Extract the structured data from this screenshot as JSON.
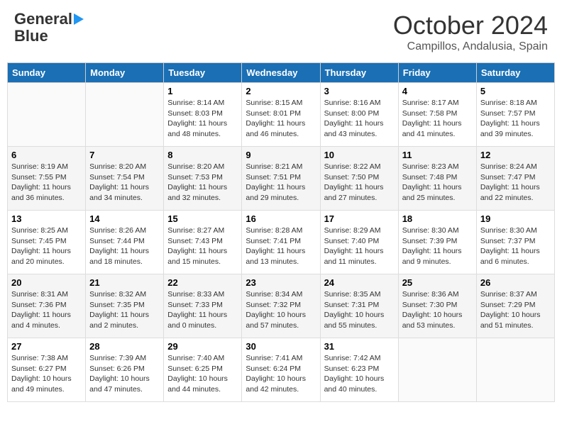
{
  "logo": {
    "line1": "General",
    "line2": "Blue"
  },
  "header": {
    "month": "October 2024",
    "location": "Campillos, Andalusia, Spain"
  },
  "weekdays": [
    "Sunday",
    "Monday",
    "Tuesday",
    "Wednesday",
    "Thursday",
    "Friday",
    "Saturday"
  ],
  "weeks": [
    [
      {
        "day": "",
        "info": ""
      },
      {
        "day": "",
        "info": ""
      },
      {
        "day": "1",
        "info": "Sunrise: 8:14 AM\nSunset: 8:03 PM\nDaylight: 11 hours and 48 minutes."
      },
      {
        "day": "2",
        "info": "Sunrise: 8:15 AM\nSunset: 8:01 PM\nDaylight: 11 hours and 46 minutes."
      },
      {
        "day": "3",
        "info": "Sunrise: 8:16 AM\nSunset: 8:00 PM\nDaylight: 11 hours and 43 minutes."
      },
      {
        "day": "4",
        "info": "Sunrise: 8:17 AM\nSunset: 7:58 PM\nDaylight: 11 hours and 41 minutes."
      },
      {
        "day": "5",
        "info": "Sunrise: 8:18 AM\nSunset: 7:57 PM\nDaylight: 11 hours and 39 minutes."
      }
    ],
    [
      {
        "day": "6",
        "info": "Sunrise: 8:19 AM\nSunset: 7:55 PM\nDaylight: 11 hours and 36 minutes."
      },
      {
        "day": "7",
        "info": "Sunrise: 8:20 AM\nSunset: 7:54 PM\nDaylight: 11 hours and 34 minutes."
      },
      {
        "day": "8",
        "info": "Sunrise: 8:20 AM\nSunset: 7:53 PM\nDaylight: 11 hours and 32 minutes."
      },
      {
        "day": "9",
        "info": "Sunrise: 8:21 AM\nSunset: 7:51 PM\nDaylight: 11 hours and 29 minutes."
      },
      {
        "day": "10",
        "info": "Sunrise: 8:22 AM\nSunset: 7:50 PM\nDaylight: 11 hours and 27 minutes."
      },
      {
        "day": "11",
        "info": "Sunrise: 8:23 AM\nSunset: 7:48 PM\nDaylight: 11 hours and 25 minutes."
      },
      {
        "day": "12",
        "info": "Sunrise: 8:24 AM\nSunset: 7:47 PM\nDaylight: 11 hours and 22 minutes."
      }
    ],
    [
      {
        "day": "13",
        "info": "Sunrise: 8:25 AM\nSunset: 7:45 PM\nDaylight: 11 hours and 20 minutes."
      },
      {
        "day": "14",
        "info": "Sunrise: 8:26 AM\nSunset: 7:44 PM\nDaylight: 11 hours and 18 minutes."
      },
      {
        "day": "15",
        "info": "Sunrise: 8:27 AM\nSunset: 7:43 PM\nDaylight: 11 hours and 15 minutes."
      },
      {
        "day": "16",
        "info": "Sunrise: 8:28 AM\nSunset: 7:41 PM\nDaylight: 11 hours and 13 minutes."
      },
      {
        "day": "17",
        "info": "Sunrise: 8:29 AM\nSunset: 7:40 PM\nDaylight: 11 hours and 11 minutes."
      },
      {
        "day": "18",
        "info": "Sunrise: 8:30 AM\nSunset: 7:39 PM\nDaylight: 11 hours and 9 minutes."
      },
      {
        "day": "19",
        "info": "Sunrise: 8:30 AM\nSunset: 7:37 PM\nDaylight: 11 hours and 6 minutes."
      }
    ],
    [
      {
        "day": "20",
        "info": "Sunrise: 8:31 AM\nSunset: 7:36 PM\nDaylight: 11 hours and 4 minutes."
      },
      {
        "day": "21",
        "info": "Sunrise: 8:32 AM\nSunset: 7:35 PM\nDaylight: 11 hours and 2 minutes."
      },
      {
        "day": "22",
        "info": "Sunrise: 8:33 AM\nSunset: 7:33 PM\nDaylight: 11 hours and 0 minutes."
      },
      {
        "day": "23",
        "info": "Sunrise: 8:34 AM\nSunset: 7:32 PM\nDaylight: 10 hours and 57 minutes."
      },
      {
        "day": "24",
        "info": "Sunrise: 8:35 AM\nSunset: 7:31 PM\nDaylight: 10 hours and 55 minutes."
      },
      {
        "day": "25",
        "info": "Sunrise: 8:36 AM\nSunset: 7:30 PM\nDaylight: 10 hours and 53 minutes."
      },
      {
        "day": "26",
        "info": "Sunrise: 8:37 AM\nSunset: 7:29 PM\nDaylight: 10 hours and 51 minutes."
      }
    ],
    [
      {
        "day": "27",
        "info": "Sunrise: 7:38 AM\nSunset: 6:27 PM\nDaylight: 10 hours and 49 minutes."
      },
      {
        "day": "28",
        "info": "Sunrise: 7:39 AM\nSunset: 6:26 PM\nDaylight: 10 hours and 47 minutes."
      },
      {
        "day": "29",
        "info": "Sunrise: 7:40 AM\nSunset: 6:25 PM\nDaylight: 10 hours and 44 minutes."
      },
      {
        "day": "30",
        "info": "Sunrise: 7:41 AM\nSunset: 6:24 PM\nDaylight: 10 hours and 42 minutes."
      },
      {
        "day": "31",
        "info": "Sunrise: 7:42 AM\nSunset: 6:23 PM\nDaylight: 10 hours and 40 minutes."
      },
      {
        "day": "",
        "info": ""
      },
      {
        "day": "",
        "info": ""
      }
    ]
  ]
}
